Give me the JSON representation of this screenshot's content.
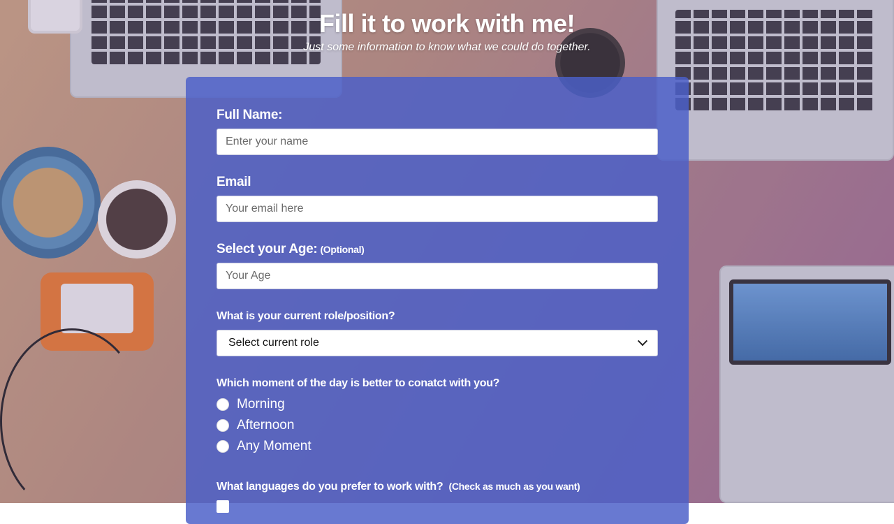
{
  "header": {
    "title": "Fill it to work with me!",
    "subtitle": "Just some information to know what we could do together."
  },
  "form": {
    "full_name": {
      "label": "Full Name:",
      "placeholder": "Enter your name"
    },
    "email": {
      "label": "Email",
      "placeholder": "Your email here"
    },
    "age": {
      "label": "Select your Age:",
      "optional_note": "(Optional)",
      "placeholder": "Your Age"
    },
    "role": {
      "label": "What is your current role/position?",
      "selected": "Select current role"
    },
    "contact_time": {
      "label": "Which moment of the day is better to conatct with you?",
      "options": [
        "Morning",
        "Afternoon",
        "Any Moment"
      ]
    },
    "languages": {
      "label": "What languages do you prefer to work with?",
      "note": "(Check as much as you want)"
    }
  },
  "colors": {
    "card_background": "#4b5fc8",
    "text": "#ffffff"
  },
  "icons": {
    "select_arrow": "chevron-down-icon",
    "radio": "radio-unchecked-icon",
    "checkbox": "checkbox-unchecked-icon"
  }
}
